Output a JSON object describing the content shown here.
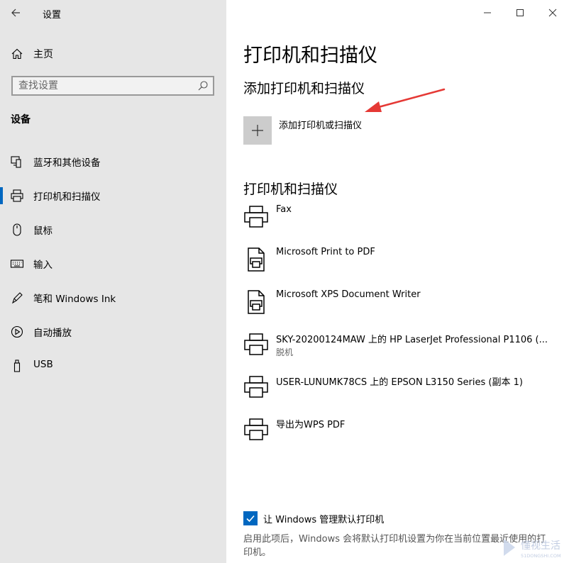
{
  "window": {
    "app_title": "设置"
  },
  "sidebar": {
    "home_label": "主页",
    "search_placeholder": "查找设置",
    "section_heading": "设备",
    "items": [
      {
        "label": "蓝牙和其他设备",
        "icon": "bluetooth-devices-icon"
      },
      {
        "label": "打印机和扫描仪",
        "icon": "printer-icon",
        "selected": true
      },
      {
        "label": "鼠标",
        "icon": "mouse-icon"
      },
      {
        "label": "输入",
        "icon": "keyboard-icon"
      },
      {
        "label": "笔和 Windows Ink",
        "icon": "pen-icon"
      },
      {
        "label": "自动播放",
        "icon": "autoplay-icon"
      },
      {
        "label": "USB",
        "icon": "usb-icon"
      }
    ]
  },
  "main": {
    "page_title": "打印机和扫描仪",
    "add_section_title": "添加打印机和扫描仪",
    "add_button_label": "添加打印机或扫描仪",
    "list_section_title": "打印机和扫描仪",
    "devices": [
      {
        "name": "Fax",
        "status": "",
        "icon": "printer-icon"
      },
      {
        "name": "Microsoft Print to PDF",
        "status": "",
        "icon": "document-printer-icon"
      },
      {
        "name": "Microsoft XPS Document Writer",
        "status": "",
        "icon": "document-printer-icon"
      },
      {
        "name": "SKY-20200124MAW 上的 HP LaserJet Professional P1106 (...",
        "status": "脱机",
        "icon": "printer-icon"
      },
      {
        "name": "USER-LUNUMK78CS 上的 EPSON L3150 Series (副本 1)",
        "status": "",
        "icon": "printer-icon"
      },
      {
        "name": "导出为WPS PDF",
        "status": "",
        "icon": "printer-icon"
      }
    ],
    "checkbox_label": "让 Windows 管理默认打印机",
    "checkbox_checked": true,
    "description": "启用此项后，Windows 会将默认打印机设置为你在当前位置最近使用的打印机。"
  },
  "colors": {
    "accent": "#0067c0",
    "sidebar_bg": "#e6e6e6",
    "annotation_arrow": "#e53935"
  },
  "watermark": {
    "text": "懂视生活",
    "subtext": "51DONGSHI.COM"
  }
}
